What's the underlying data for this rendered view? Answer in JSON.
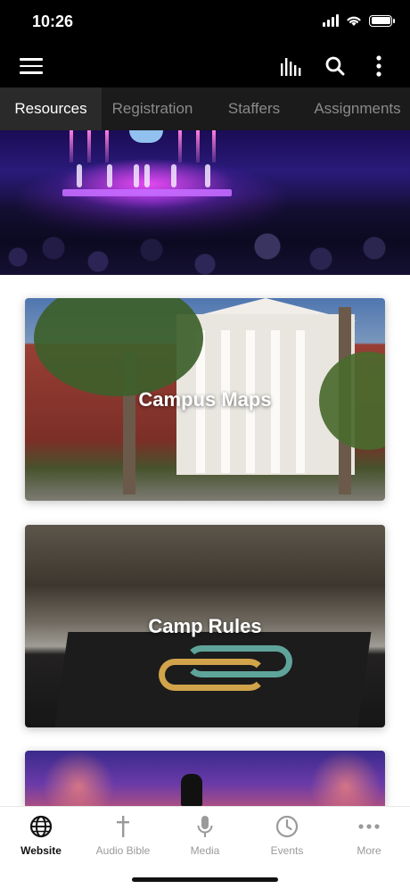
{
  "status_bar": {
    "time": "10:26"
  },
  "toolbar": {
    "icons": [
      "menu-icon",
      "bar-chart-icon",
      "search-icon",
      "more-vertical-icon"
    ]
  },
  "tabs": [
    {
      "label": "Resources",
      "active": true
    },
    {
      "label": "Registration",
      "active": false
    },
    {
      "label": "Staffers",
      "active": false
    },
    {
      "label": "Assignments",
      "active": false
    }
  ],
  "cards": [
    {
      "title": "Campus Maps"
    },
    {
      "title": "Camp Rules"
    }
  ],
  "bottom_nav": [
    {
      "label": "Website",
      "icon": "globe-icon",
      "active": true
    },
    {
      "label": "Audio Bible",
      "icon": "cross-icon",
      "active": false
    },
    {
      "label": "Media",
      "icon": "microphone-icon",
      "active": false
    },
    {
      "label": "Events",
      "icon": "clock-icon",
      "active": false
    },
    {
      "label": "More",
      "icon": "more-horizontal-icon",
      "active": false
    }
  ],
  "colors": {
    "header_bg": "#000000",
    "tab_bar_bg": "#1b1b1b",
    "tab_active_bg": "#2a2a2a",
    "tab_inactive_text": "#8a8a8a",
    "nav_active_text": "#111111",
    "nav_inactive_text": "#9a9a9a"
  }
}
